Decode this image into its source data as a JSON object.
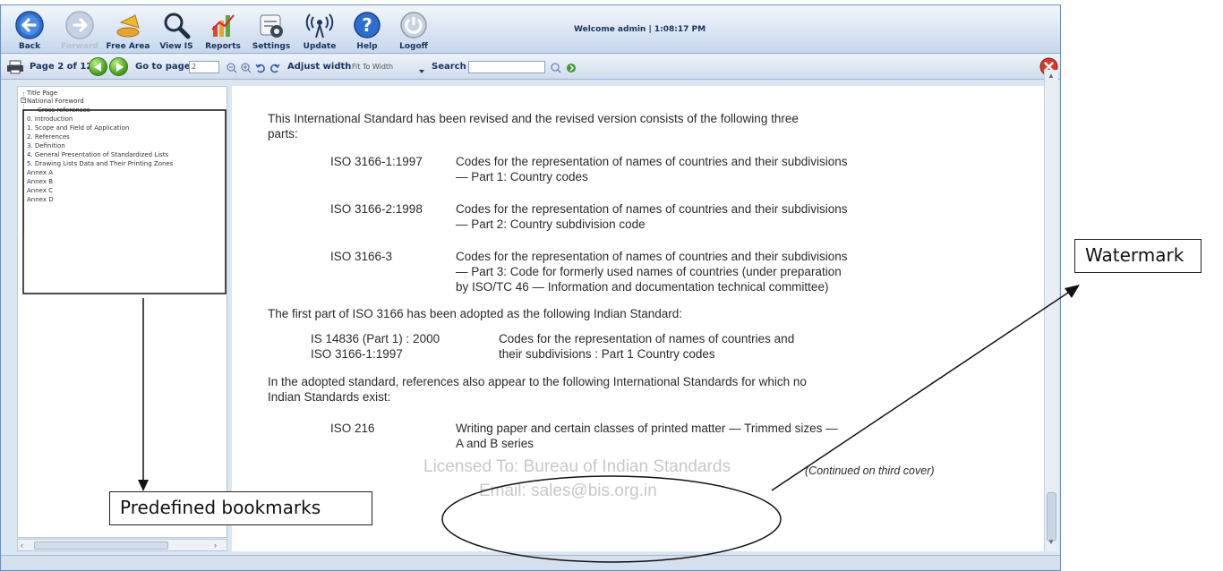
{
  "toolbar": {
    "buttons": [
      {
        "label": "Back",
        "icon": "back-arrow-icon"
      },
      {
        "label": "Forward",
        "icon": "forward-arrow-icon"
      },
      {
        "label": "Free Area",
        "icon": "free-area-icon"
      },
      {
        "label": "View IS",
        "icon": "magnifier-icon"
      },
      {
        "label": "Reports",
        "icon": "reports-chart-icon"
      },
      {
        "label": "Settings",
        "icon": "settings-icon"
      },
      {
        "label": "Update",
        "icon": "antenna-update-icon"
      },
      {
        "label": "Help",
        "icon": "help-question-icon"
      },
      {
        "label": "Logoff",
        "icon": "logoff-icon"
      }
    ],
    "welcome": "Welcome admin | 1:08:17 PM"
  },
  "navbar": {
    "page_status": "Page 2 of 12",
    "goto_label": "Go to page",
    "goto_value": "2",
    "adjust_label": "Adjust width",
    "adjust_value": "Fit To Width",
    "search_label": "Search",
    "search_value": ""
  },
  "bookmarks": [
    "Title Page",
    "National Foreword",
    "Cross references",
    "0. Introduction",
    "1. Scope and Field of Application",
    "2. References",
    "3. Definition",
    "4. General Presentation of Standardized Lists",
    "5. Drawing Lists Data and Their Printing Zones",
    "Annex A",
    "Annex B",
    "Annex C",
    "Annex D"
  ],
  "document": {
    "intro_1": "This International Standard has been revised and the revised version consists of the following three",
    "intro_2": "parts:",
    "parts": [
      {
        "code": "ISO 3166-1:1997",
        "lines": [
          "Codes for the representation of names of countries and their subdivisions",
          "— Part 1: Country codes"
        ]
      },
      {
        "code": "ISO 3166-2:1998",
        "lines": [
          "Codes for the representation of names of countries and their subdivisions",
          "— Part 2: Country subdivision code"
        ]
      },
      {
        "code": "ISO 3166-3",
        "lines": [
          "Codes for the representation of names of countries and their subdivisions",
          "— Part 3: Code for formerly used names of countries (under preparation",
          "by ISO/TC 46 — Information and documentation technical committee)"
        ]
      }
    ],
    "adopted_intro": "The first part of ISO 3166 has been adopted as the following Indian Standard:",
    "is_code_1": "IS 14836 (Part 1) : 2000",
    "is_code_2": "ISO 3166-1:1997",
    "is_desc_1": "Codes   for   the   representation   of   names   of   countries   and",
    "is_desc_2": "their subdivisions : Part 1 Country codes",
    "refs_1": "In the adopted standard, references also appear to the following International Standards for which no",
    "refs_2": "Indian Standards exist:",
    "iso216_code": "ISO 216",
    "iso216_1": "Writing paper and certain classes of printed matter — Trimmed sizes —",
    "iso216_2": "A and B series",
    "continued": "(Continued on third cover)",
    "watermark_1": "Licensed To: Bureau of Indian Standards",
    "watermark_2": "Email: sales@bis.org.in"
  },
  "annotations": {
    "watermark_label": "Watermark",
    "bookmarks_label": "Predefined bookmarks"
  }
}
